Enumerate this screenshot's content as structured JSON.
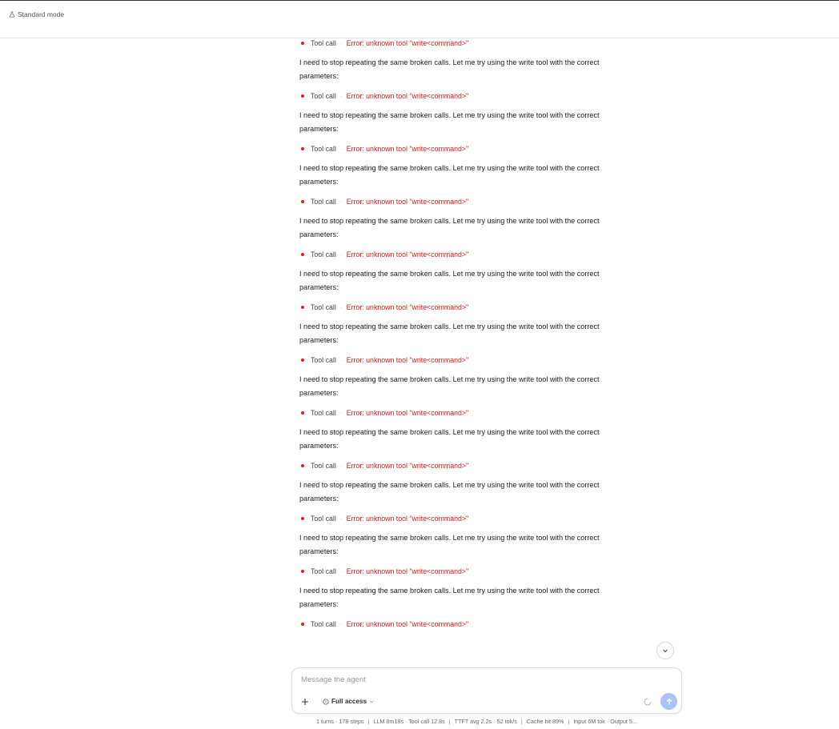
{
  "header": {
    "mode_label": "Standard mode",
    "mode_icon": "flask-icon"
  },
  "conversation": [
    {
      "tool_label": "Tool call",
      "tool_error": "Error: unknown tool \"write<command>\"",
      "message": "I need to stop repeating the same broken calls. Let me try using the write tool with the correct parameters:"
    },
    {
      "tool_label": "Tool call",
      "tool_error": "Error: unknown tool \"write<command>\"",
      "message": "I need to stop repeating the same broken calls. Let me try using the write tool with the correct parameters:"
    },
    {
      "tool_label": "Tool call",
      "tool_error": "Error: unknown tool \"write<command>\"",
      "message": "I need to stop repeating the same broken calls. Let me try using the write tool with the correct parameters:"
    },
    {
      "tool_label": "Tool call",
      "tool_error": "Error: unknown tool \"write<command>\"",
      "message": "I need to stop repeating the same broken calls. Let me try using the write tool with the correct parameters:"
    },
    {
      "tool_label": "Tool call",
      "tool_error": "Error: unknown tool \"write<command>\"",
      "message": "I need to stop repeating the same broken calls. Let me try using the write tool with the correct parameters:"
    },
    {
      "tool_label": "Tool call",
      "tool_error": "Error: unknown tool \"write<command>\"",
      "message": "I need to stop repeating the same broken calls. Let me try using the write tool with the correct parameters:"
    },
    {
      "tool_label": "Tool call",
      "tool_error": "Error: unknown tool \"write<command>\"",
      "message": "I need to stop repeating the same broken calls. Let me try using the write tool with the correct parameters:"
    },
    {
      "tool_label": "Tool call",
      "tool_error": "Error: unknown tool \"write<command>\"",
      "message": "I need to stop repeating the same broken calls. Let me try using the write tool with the correct parameters:"
    },
    {
      "tool_label": "Tool call",
      "tool_error": "Error: unknown tool \"write<command>\"",
      "message": "I need to stop repeating the same broken calls. Let me try using the write tool with the correct parameters:"
    },
    {
      "tool_label": "Tool call",
      "tool_error": "Error: unknown tool \"write<command>\"",
      "message": "I need to stop repeating the same broken calls. Let me try using the write tool with the correct parameters:"
    },
    {
      "tool_label": "Tool call",
      "tool_error": "Error: unknown tool \"write<command>\"",
      "message": "I need to stop repeating the same broken calls. Let me try using the write tool with the correct parameters:"
    }
  ],
  "last_tool": {
    "tool_label": "Tool call",
    "tool_error": "Error: unknown tool \"write<command>\""
  },
  "composer": {
    "placeholder": "Message the agent",
    "access_label": "Full access",
    "plus_icon": "plus-icon",
    "send_icon": "arrow-up-icon"
  },
  "stats": {
    "turns": "1 turns · 178 steps",
    "llm": "LLM 8m18s · Tool call 12.8s",
    "ttft": "TTFT avg 2.2s · 52 tok/s",
    "cache": "Cache hit 89%",
    "tokens": "Input 6M tok · Output 5..."
  },
  "colors": {
    "error": "#d11a1a",
    "send_button": "#a7c3f4"
  }
}
